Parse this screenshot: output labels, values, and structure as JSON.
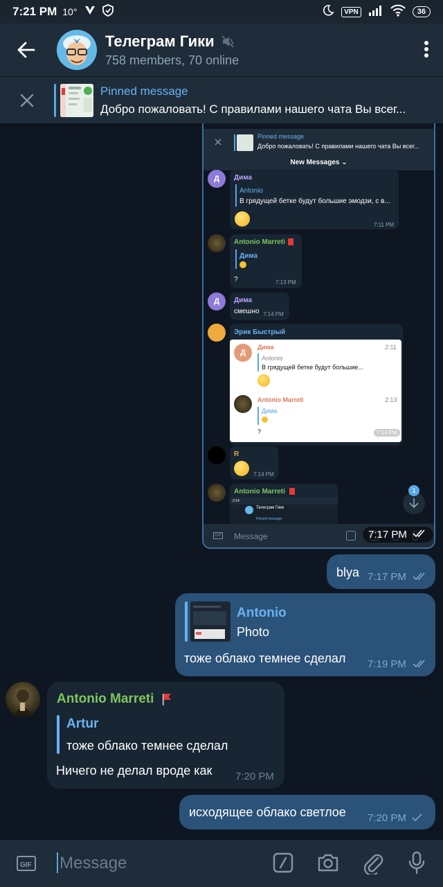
{
  "status": {
    "time": "7:21 PM",
    "temp": "10°",
    "vpn": "VPN",
    "battery": "36"
  },
  "header": {
    "title": "Телеграм Гики",
    "subtitle": "758 members, 70 online"
  },
  "pinned": {
    "title": "Pinned message",
    "text": "Добро пожаловать! С правилами нашего чата Вы всег..."
  },
  "screenshot": {
    "pinned_title": "Pinned message",
    "pinned_text": "Добро пожаловать! С правилами нашего чата Вы всег...",
    "new_messages": "New Messages",
    "messages": [
      {
        "avatar": "Д",
        "name": "Дима",
        "quote_name": "Antonio",
        "quote_text": "В грядущей бетке будут большие эмодзи, с в...",
        "time": "7:11 PM"
      },
      {
        "name": "Antonio Marreti",
        "quote_name": "Дима",
        "text": "?",
        "time": "7:13 PM"
      },
      {
        "avatar": "Д",
        "name": "Дима",
        "text": "смешно",
        "time": "7:14 PM"
      },
      {
        "name": "Эрик Быстрый"
      },
      {
        "name": "R",
        "time": "7:14 PM"
      },
      {
        "name": "Antonio Marreti"
      }
    ],
    "card": {
      "avatar": "Д",
      "name1": "Дима",
      "time1": "2:11",
      "quote1_name": "Antonio",
      "quote1_text": "В грядущей бетке будут большие...",
      "name2": "Antonio Marreti",
      "time2": "2:13",
      "quote2_name": "Дима",
      "text2": "?",
      "time3": "7:14 PM"
    },
    "mini_header_title": "Телеграм Гики",
    "mini_pinned": "Pinned message",
    "input_placeholder": "Message",
    "scroll_badge": "1",
    "time": "7:17 PM"
  },
  "messages": [
    {
      "text": "blya",
      "time": "7:17 PM"
    },
    {
      "quote_name": "Antonio",
      "quote_text": "Photo",
      "text": "тоже облако темнее сделал",
      "time": "7:19 PM"
    },
    {
      "sender": "Antonio Marreti",
      "quote_name": "Artur",
      "quote_text": "тоже облако темнее сделал",
      "text": "Ничего не делал вроде как",
      "time": "7:20 PM"
    },
    {
      "text": "исходящее облако светлое",
      "time": "7:20 PM"
    }
  ],
  "input": {
    "placeholder": "Message"
  },
  "colors": {
    "background": "#0e1621",
    "header": "#1f2c39",
    "outgoing_bubble": "#2b5278",
    "incoming_bubble": "#182533",
    "accent": "#6ab2f2",
    "sender_green": "#7fc65d"
  }
}
